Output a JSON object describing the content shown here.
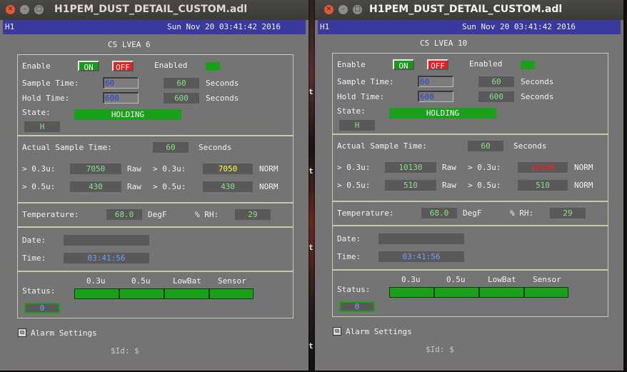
{
  "desktop": {
    "edge_marks": [
      "t",
      "t",
      "t",
      "t"
    ]
  },
  "windows": [
    {
      "title": "H1PEM_DUST_DETAIL_CUSTOM.adl",
      "header": {
        "site": "H1",
        "datetime": "Sun Nov 20 03:41:42 2016"
      },
      "location": "CS LVEA 6",
      "enable": {
        "label": "Enable",
        "on": "ON",
        "off": "OFF",
        "status_label": "Enabled"
      },
      "sample_time": {
        "label": "Sample Time:",
        "input": "60",
        "value": "60",
        "unit": "Seconds"
      },
      "hold_time": {
        "label": "Hold Time:",
        "input": "600",
        "value": "600",
        "unit": "Seconds"
      },
      "state": {
        "label": "State:",
        "value": "HOLDING",
        "code": "H"
      },
      "actual_sample_time": {
        "label": "Actual Sample Time:",
        "value": "60",
        "unit": "Seconds"
      },
      "counts": [
        {
          "size": "> 0.3u:",
          "raw": "7050",
          "raw_label": "Raw",
          "norm_size": "> 0.3u:",
          "norm": "7050",
          "norm_label": "NORM",
          "norm_color": "#ffff40"
        },
        {
          "size": "> 0.5u:",
          "raw": "430",
          "raw_label": "Raw",
          "norm_size": "> 0.5u:",
          "norm": "430",
          "norm_label": "NORM",
          "norm_color": "#8cde8c"
        }
      ],
      "temperature": {
        "label": "Temperature:",
        "value": "68.0",
        "unit": "DegF",
        "rh_label": "% RH:",
        "rh": "29"
      },
      "date": {
        "label": "Date:",
        "value": ""
      },
      "time": {
        "label": "Time:",
        "value": "03:41:56"
      },
      "status": {
        "label": "Status:",
        "columns": [
          "0.3u",
          "0.5u",
          "LowBat",
          "Sensor"
        ],
        "value": "0"
      },
      "alarm_settings": "Alarm Settings",
      "footer": "$Id: $"
    },
    {
      "title": "H1PEM_DUST_DETAIL_CUSTOM.adl",
      "header": {
        "site": "H1",
        "datetime": "Sun Nov 20 03:41:42 2016"
      },
      "location": "CS LVEA 10",
      "enable": {
        "label": "Enable",
        "on": "ON",
        "off": "OFF",
        "status_label": "Enabled"
      },
      "sample_time": {
        "label": "Sample Time:",
        "input": "60",
        "value": "60",
        "unit": "Seconds"
      },
      "hold_time": {
        "label": "Hold Time:",
        "input": "600",
        "value": "600",
        "unit": "Seconds"
      },
      "state": {
        "label": "State:",
        "value": "HOLDING",
        "code": "H"
      },
      "actual_sample_time": {
        "label": "Actual Sample Time:",
        "value": "60",
        "unit": "Seconds"
      },
      "counts": [
        {
          "size": "> 0.3u:",
          "raw": "10130",
          "raw_label": "Raw",
          "norm_size": "> 0.3u:",
          "norm": "10130",
          "norm_label": "NORM",
          "norm_color": "#ff2020"
        },
        {
          "size": "> 0.5u:",
          "raw": "510",
          "raw_label": "Raw",
          "norm_size": "> 0.5u:",
          "norm": "510",
          "norm_label": "NORM",
          "norm_color": "#8cde8c"
        }
      ],
      "temperature": {
        "label": "Temperature:",
        "value": "68.0",
        "unit": "DegF",
        "rh_label": "% RH:",
        "rh": "29"
      },
      "date": {
        "label": "Date:",
        "value": ""
      },
      "time": {
        "label": "Time:",
        "value": "03:41:56"
      },
      "status": {
        "label": "Status:",
        "columns": [
          "0.3u",
          "0.5u",
          "LowBat",
          "Sensor"
        ],
        "value": "0"
      },
      "alarm_settings": "Alarm Settings",
      "footer": "$Id: $"
    }
  ]
}
